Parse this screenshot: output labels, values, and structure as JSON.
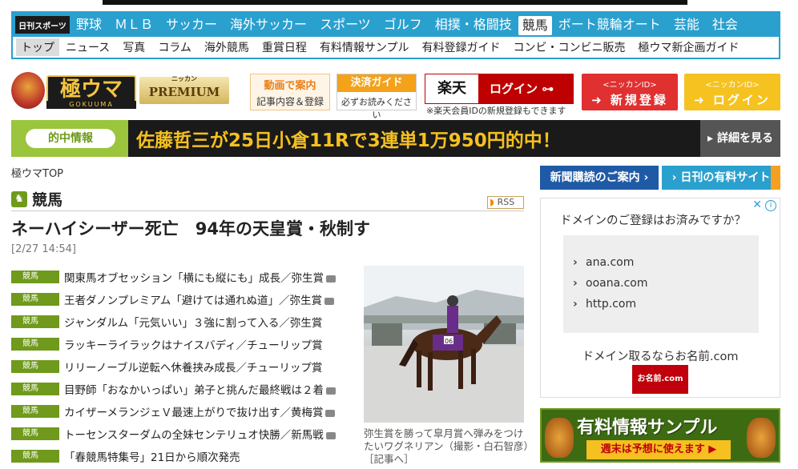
{
  "nav": {
    "brand": "日刊スポーツ",
    "categories": [
      "野球",
      "ＭＬＢ",
      "サッカー",
      "海外サッカー",
      "スポーツ",
      "ゴルフ",
      "相撲・格闘技",
      "競馬",
      "ボート競輪オート",
      "芸能",
      "社会"
    ],
    "active_category": "競馬",
    "subnav": [
      "トップ",
      "ニュース",
      "写真",
      "コラム",
      "海外競馬",
      "重賞日程",
      "有料情報サンプル",
      "有料登録ガイド",
      "コンビ・コンビニ販売",
      "極ウマ新企画ガイド"
    ]
  },
  "header": {
    "logo_text": "極ウマ",
    "logo_sub": "GOKUUMA",
    "premium_kana": "ニッカン",
    "premium": "PREMIUM",
    "video_title": "動画で案内",
    "video_sub": "記事内容＆登録",
    "pay_title": "決済ガイド",
    "pay_sub": "必ずお読みください",
    "rakuten_logo": "楽天",
    "rakuten_login": "ログイン",
    "rakuten_note": "※楽天会員IDの新規登録もできます",
    "register_small": "<ニッカンID>",
    "register_label": "新規登録",
    "idlogin_small": "<ニッカンID>",
    "idlogin_label": "ログイン"
  },
  "hit": {
    "label": "的中情報",
    "text": "佐藤哲三が25日小倉11Rで3連単1万950円的中！",
    "more": "詳細を見る"
  },
  "content": {
    "breadcrumb": "極ウマTOP",
    "section": "競馬",
    "rss": "RSS",
    "headline": "ネーハイシーザー死亡　94年の天皇賞・秋制す",
    "date": "[2/27 14:54]",
    "category_badge": "競馬",
    "news": [
      {
        "title": "関東馬オブセッション「横にも縦にも」成長／弥生賞",
        "photo": true
      },
      {
        "title": "王者ダノンプレミアム「避けては通れぬ道」／弥生賞",
        "photo": true
      },
      {
        "title": "ジャンダルム「元気いい」３強に割って入る／弥生賞",
        "photo": false
      },
      {
        "title": "ラッキーライラックはナイスバディ／チューリップ賞",
        "photo": false
      },
      {
        "title": "リリーノーブル逆転へ休養挟み成長／チューリップ賞",
        "photo": false
      },
      {
        "title": "目野師「おなかいっぱい」弟子と挑んだ最終戦は２着",
        "photo": true
      },
      {
        "title": "カイザーメランジェＶ最速上がりで抜け出す／黄梅賞",
        "photo": true
      },
      {
        "title": "トーセンスターダムの全妹センテリュオ快勝／新馬戦",
        "photo": true
      },
      {
        "title": "「春競馬特集号」21日から順次発売",
        "photo": false
      }
    ],
    "photo_caption": "弥生賞を勝って皐月賞へ弾みをつけたいワグネリアン（撮影・白石智彦）［記事へ］",
    "photo_bib": "06"
  },
  "right": {
    "subscribe": "新聞購読のご案内",
    "paid_site": "日刊の有料サイト",
    "ad": {
      "heading": "ドメインのご登録はお済みですか？",
      "links": [
        "ana.com",
        "ooana.com",
        "http.com"
      ],
      "footer": "ドメイン取るならお名前.com",
      "logo": "お名前.com",
      "info": "i",
      "close": "✕"
    },
    "sample": {
      "title": "有料情報サンプル",
      "sub": "週末は予想に使えます"
    }
  },
  "colors": {
    "nav_blue": "#2aa0cf",
    "green": "#6f9a1c",
    "hit_yellow": "#f5c020",
    "rakuten_red": "#bf0000"
  }
}
